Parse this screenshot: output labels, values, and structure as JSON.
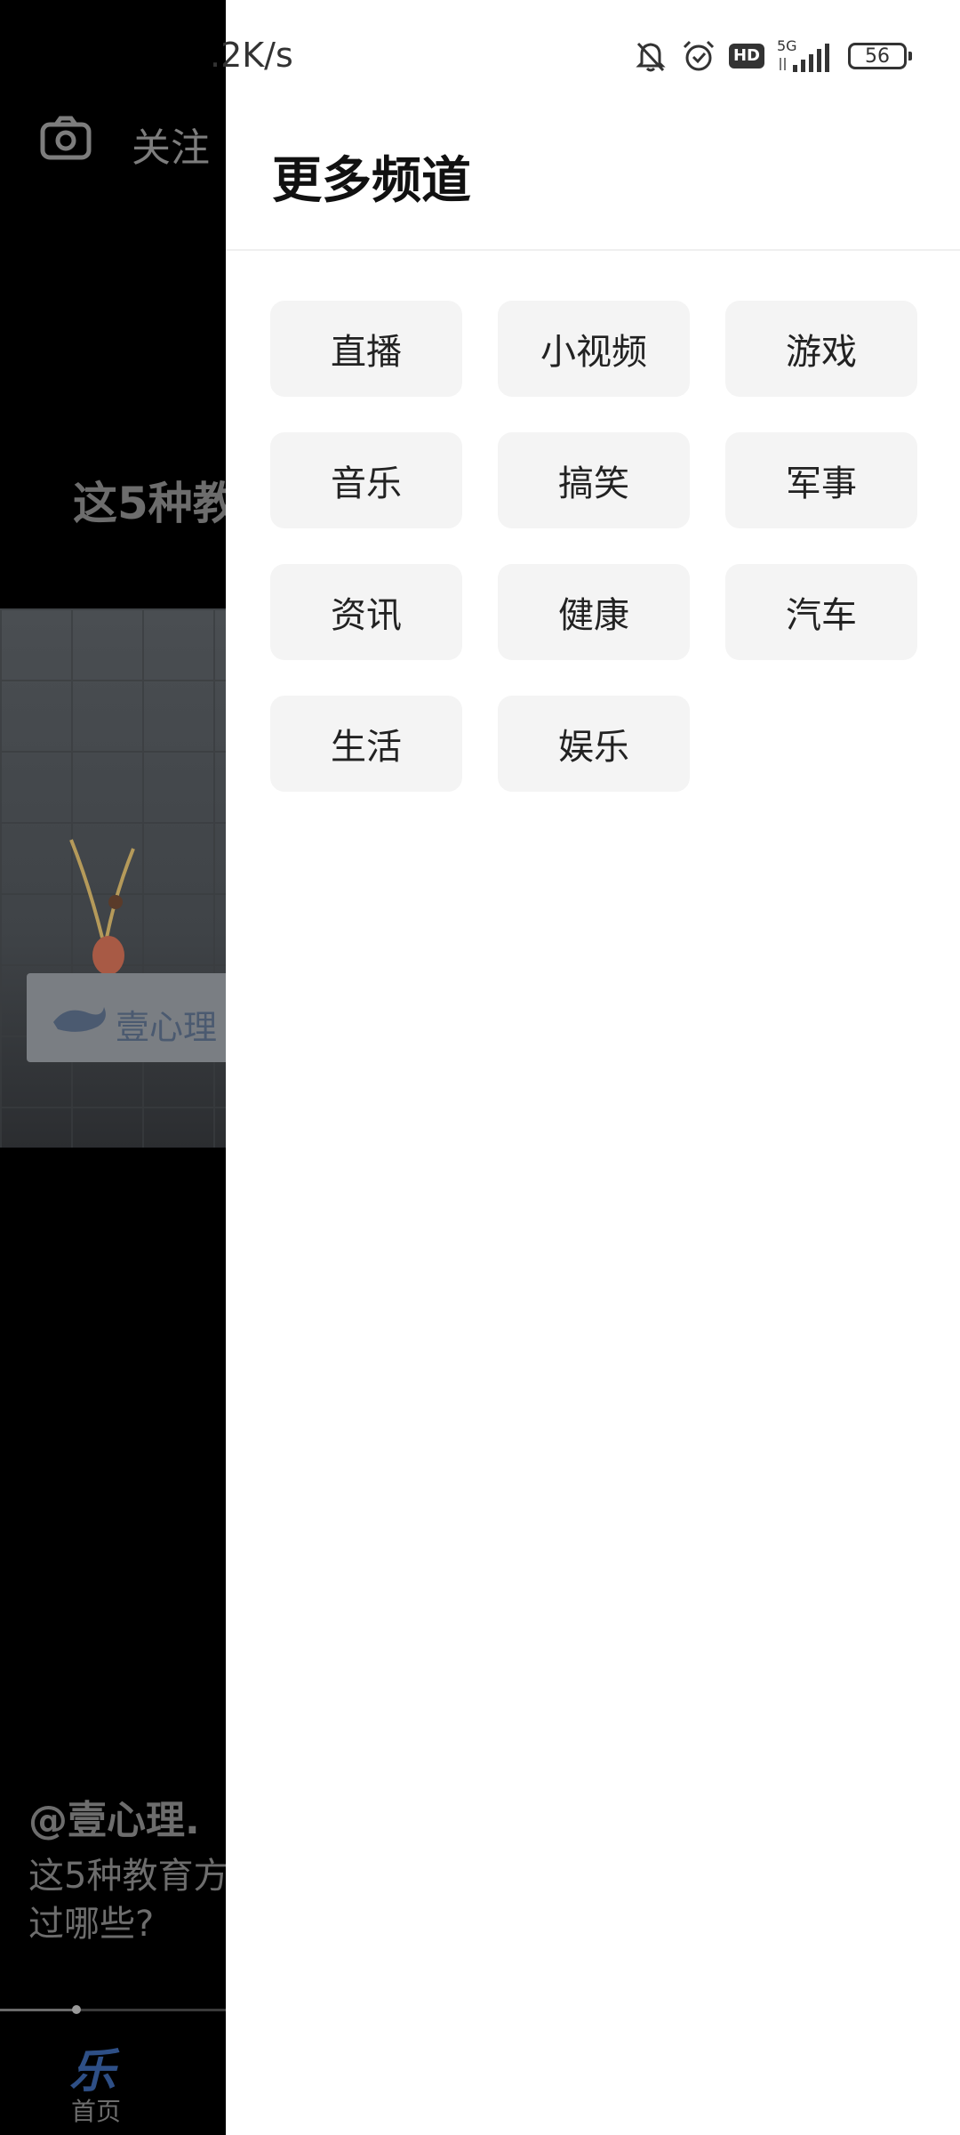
{
  "status_bar": {
    "network_speed": ".2K/s",
    "icons": [
      "mute-bell-icon",
      "alarm-icon",
      "hd-icon",
      "5g-signal-icon",
      "battery-icon"
    ],
    "hd_label": "HD",
    "network_type": "5G",
    "battery_level": "56"
  },
  "background": {
    "follow_label": "关注",
    "headline": "这5种教",
    "author": "@壹心理.",
    "description": "这5种教育方\n过哪些?",
    "sign_text": "壹心理",
    "progress": 0.33,
    "nav_logo": "乐",
    "nav_home_label": "首页"
  },
  "drawer": {
    "title": "更多频道",
    "channels": [
      "直播",
      "小视频",
      "游戏",
      "音乐",
      "搞笑",
      "军事",
      "资讯",
      "健康",
      "汽车",
      "生活",
      "娱乐"
    ]
  },
  "colors": {
    "drawer_bg": "#ffffff",
    "chip_bg": "#f4f4f4",
    "overlay_dim": "#000000",
    "nav_logo": "#2e4f86"
  }
}
